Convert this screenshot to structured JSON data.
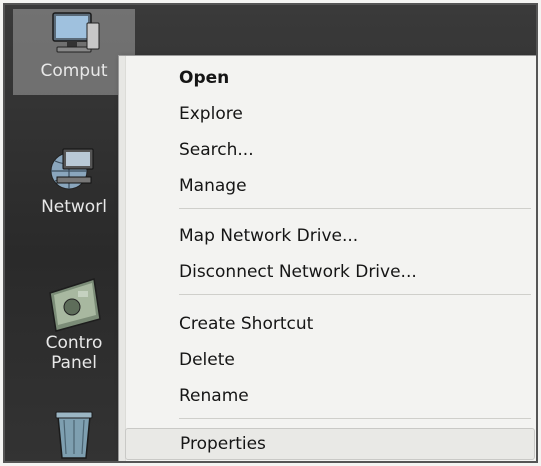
{
  "desktop": {
    "icons": [
      {
        "label": "Comput",
        "icon": "computer-icon",
        "selected": true
      },
      {
        "label": "Networl",
        "icon": "network-icon",
        "selected": false
      },
      {
        "label": "Contro\nPanel",
        "icon": "control-panel-icon",
        "selected": false
      },
      {
        "label": "",
        "icon": "recycle-bin-icon",
        "selected": false
      }
    ]
  },
  "context_menu": {
    "items": [
      {
        "label": "Open",
        "bold": true
      },
      {
        "label": "Explore"
      },
      {
        "label": "Search..."
      },
      {
        "label": "Manage"
      },
      {
        "label": "Map Network Drive..."
      },
      {
        "label": "Disconnect Network Drive..."
      },
      {
        "label": "Create Shortcut"
      },
      {
        "label": "Delete"
      },
      {
        "label": "Rename"
      },
      {
        "label": "Properties",
        "highlighted": true
      }
    ]
  }
}
